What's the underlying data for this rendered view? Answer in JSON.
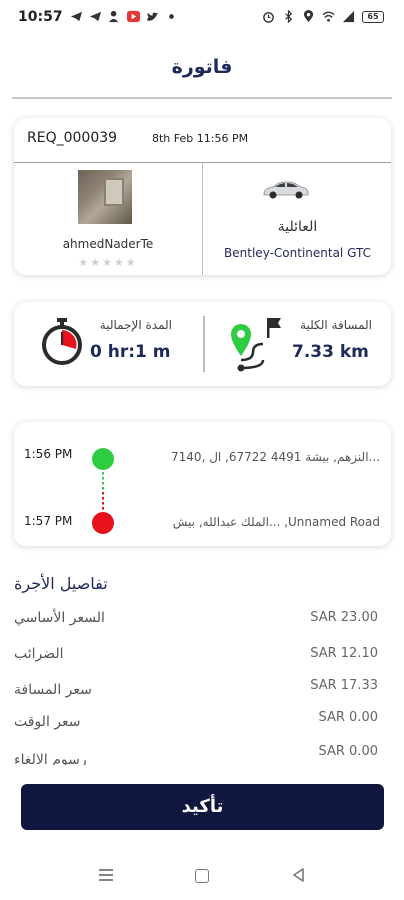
{
  "status_bar": {
    "time": "10:57",
    "battery": "65"
  },
  "header": {
    "title": "فاتورة"
  },
  "request": {
    "id": "REQ_000039",
    "date": "8th Feb 11:56 PM",
    "driver_name": "ahmedNaderTe",
    "stars": "★★★★★",
    "car_category": "العائلية",
    "car_model": "Bentley-Continental GTC"
  },
  "trip_stats": {
    "duration_label": "المدة الإجمالية",
    "duration_value": "0 hr:1 m",
    "distance_label": "المسافة الكلية",
    "distance_value": "7.33 km"
  },
  "route": {
    "pickup_time": "1:56 PM",
    "pickup_address": "7140, النزهم, بيشة 4491 67722, ال...",
    "dropoff_time": "1:57 PM",
    "dropoff_address": "الملك عبدالله, بيش... ,Unnamed Road"
  },
  "fare": {
    "title": "تفاصيل الأجرة",
    "rows": [
      {
        "label": "السعر الأساسي",
        "amount": "SAR 23.00"
      },
      {
        "label": "الضرائب",
        "amount": "SAR 12.10"
      },
      {
        "label": "سعر المسافة",
        "amount": "SAR 17.33"
      },
      {
        "label": "سعر الوقت",
        "amount": "SAR 0.00"
      },
      {
        "label": "رسوم الالغاء",
        "amount": "SAR 0.00"
      }
    ]
  },
  "confirm_button": {
    "label": "تأكيد"
  },
  "colors": {
    "primary": "#10163d",
    "title": "#1e2a5a",
    "pickup": "#2ecc40",
    "dropoff": "#e8101a"
  }
}
